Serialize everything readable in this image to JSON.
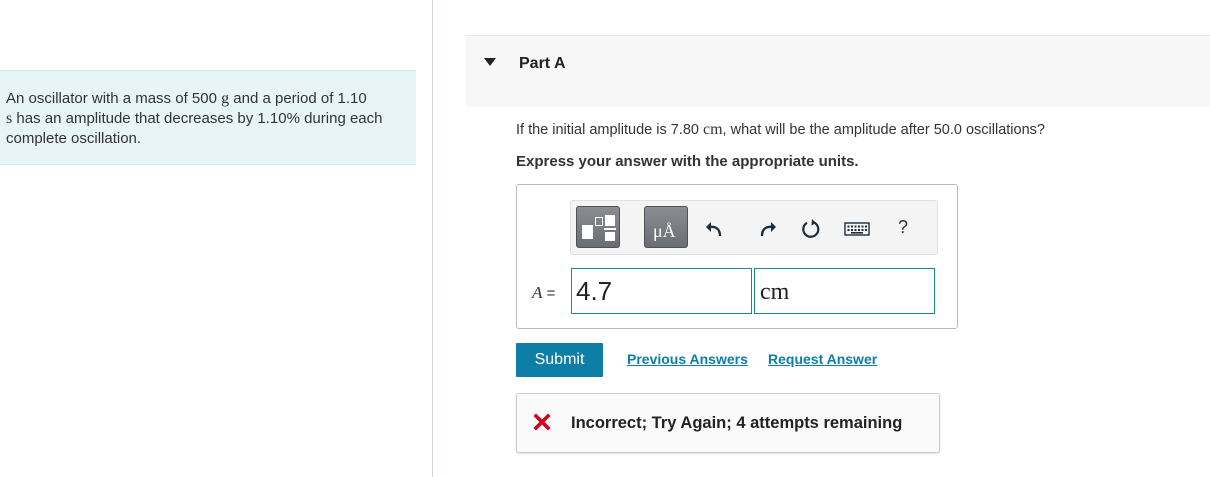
{
  "problem": {
    "text_1": "An oscillator with a mass of 500",
    "mass_unit": "g",
    "text_2": "and a period of 1.10",
    "period_unit": "s",
    "text_3": "has an amplitude that decreases by 1.10% during each complete oscillation."
  },
  "part": {
    "title": "Part A",
    "question_before": "If the initial amplitude is 7.80",
    "question_unit": "cm",
    "question_after": ", what will be the amplitude after 50.0 oscillations?",
    "instruction": "Express your answer with the appropriate units."
  },
  "toolbar": {
    "units_label": "μÅ",
    "help_label": "?",
    "icons": [
      "templates-icon",
      "units-icon",
      "undo-icon",
      "redo-icon",
      "reset-icon",
      "keyboard-icon",
      "help-icon"
    ]
  },
  "answer": {
    "variable": "A",
    "equals": "=",
    "value": "4.7",
    "unit": "cm"
  },
  "actions": {
    "submit_label": "Submit",
    "previous_answers_label": "Previous Answers",
    "request_answer_label": "Request Answer"
  },
  "feedback": {
    "text": "Incorrect; Try Again; 4 attempts remaining",
    "status_color": "#d0021b"
  },
  "colors": {
    "accent": "#0d7ea6",
    "input_border": "#1b8a8c",
    "problem_bg": "#e8f5f7"
  }
}
